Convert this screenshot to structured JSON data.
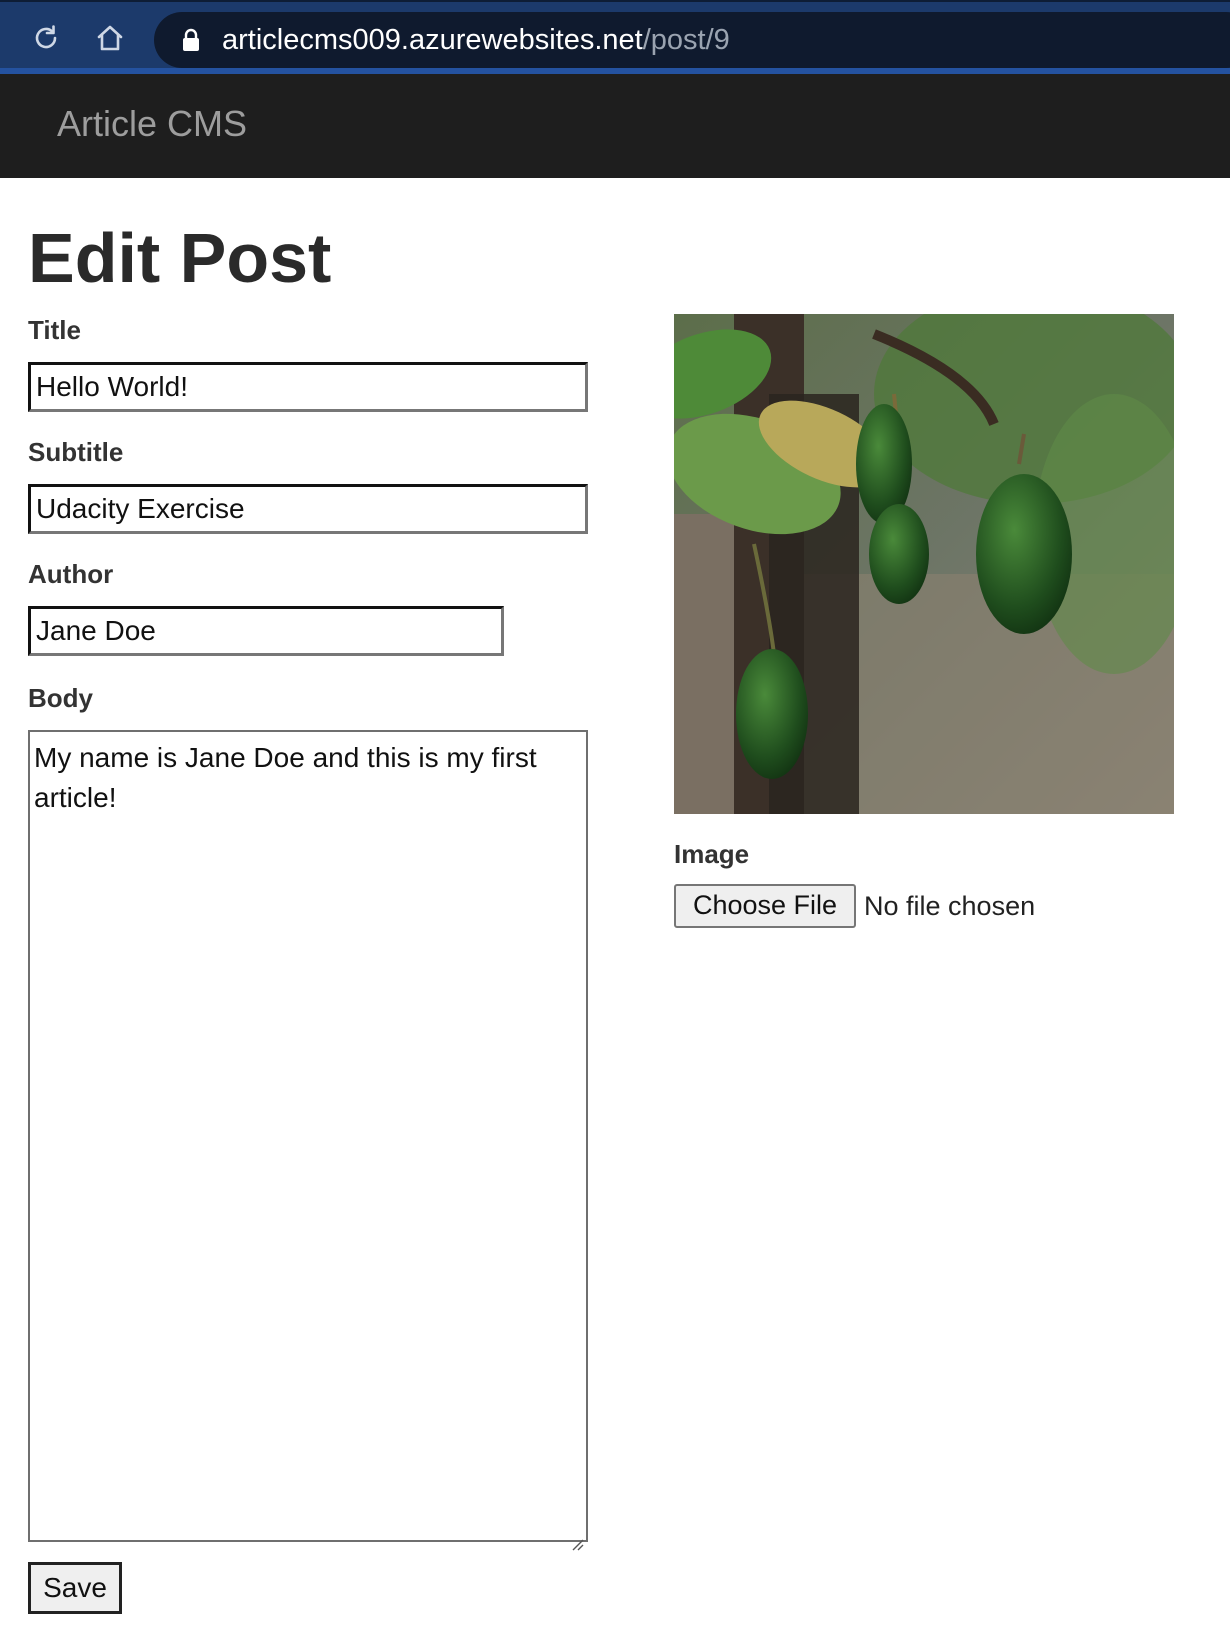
{
  "browser": {
    "url_host": "articlecms009.azurewebsites.net",
    "url_path": "/post/9",
    "reload_icon": "reload-icon",
    "home_icon": "home-icon",
    "lock_icon": "lock-icon"
  },
  "navbar": {
    "brand": "Article CMS"
  },
  "page": {
    "title": "Edit Post"
  },
  "form": {
    "title_label": "Title",
    "title_value": "Hello World!",
    "subtitle_label": "Subtitle",
    "subtitle_value": "Udacity Exercise",
    "author_label": "Author",
    "author_value": "Jane Doe",
    "body_label": "Body",
    "body_value": "My name is Jane Doe and this is my first article!",
    "save_label": "Save"
  },
  "image_panel": {
    "image_description": "",
    "image_label": "Image",
    "choose_file_label": "Choose File",
    "file_status": "No file chosen"
  },
  "colors": {
    "browser_bar": "#1c3a6b",
    "url_box": "#0f1a2e",
    "navbar": "#1e1e1e",
    "brand_text": "#9d9d9d"
  }
}
